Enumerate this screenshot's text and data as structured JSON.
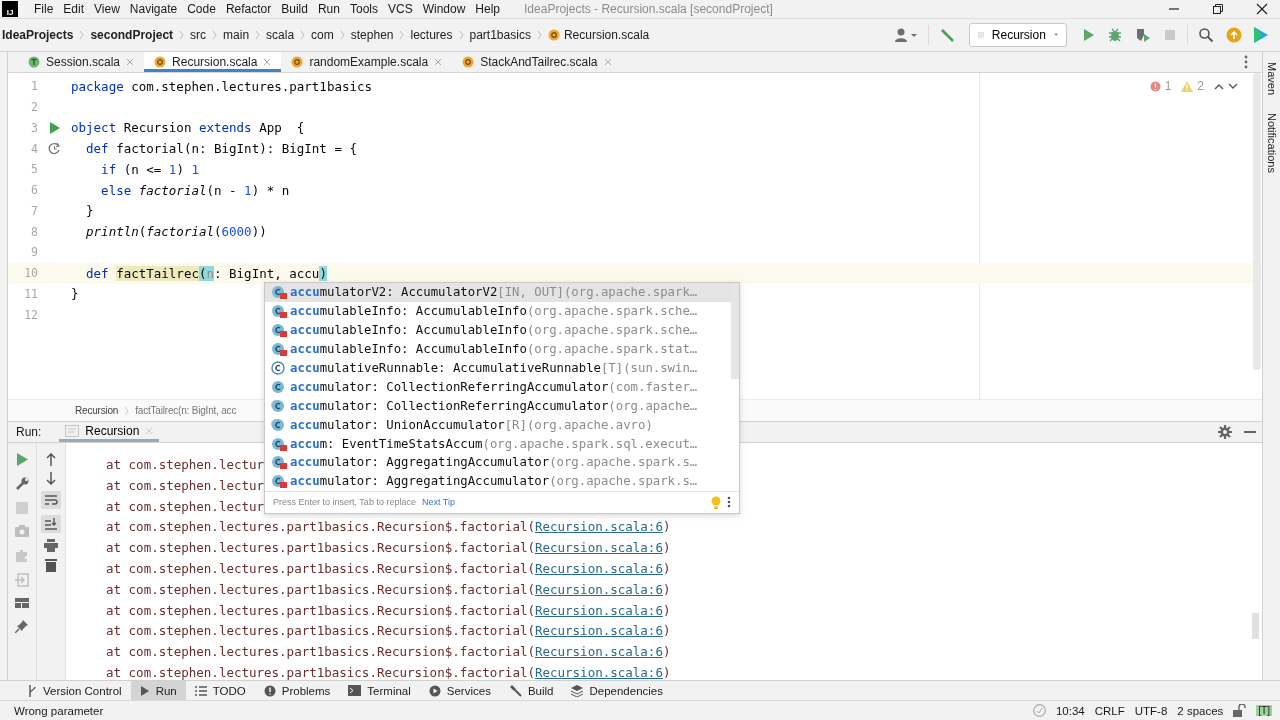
{
  "title_bar": {
    "logo": "IJ",
    "menu": [
      "File",
      "Edit",
      "View",
      "Navigate",
      "Code",
      "Refactor",
      "Build",
      "Run",
      "Tools",
      "VCS",
      "Window",
      "Help"
    ],
    "title": "IdeaProjects - Recursion.scala [secondProject]"
  },
  "nav_bar": {
    "breadcrumbs": [
      {
        "label": "IdeaProjects",
        "kind": "project"
      },
      {
        "label": "secondProject",
        "kind": "project"
      },
      {
        "label": "src",
        "kind": "dir"
      },
      {
        "label": "main",
        "kind": "dir"
      },
      {
        "label": "scala",
        "kind": "dir"
      },
      {
        "label": "com",
        "kind": "dir"
      },
      {
        "label": "stephen",
        "kind": "dir"
      },
      {
        "label": "lectures",
        "kind": "dir"
      },
      {
        "label": "part1basics",
        "kind": "dir"
      },
      {
        "label": "Recursion.scala",
        "kind": "file"
      }
    ],
    "run_config": "Recursion"
  },
  "tabs": [
    {
      "label": "Session.scala",
      "kind": "worksheet",
      "selected": false
    },
    {
      "label": "Recursion.scala",
      "kind": "object",
      "selected": true
    },
    {
      "label": "randomExample.scala",
      "kind": "object",
      "selected": false
    },
    {
      "label": "StackAndTailrec.scala",
      "kind": "object",
      "selected": false
    }
  ],
  "editor": {
    "inspections": {
      "errors": "1",
      "warnings": "2"
    },
    "lines": [
      {
        "number": "1",
        "kind": "plain",
        "current": false,
        "tokens": [
          {
            "t": "package",
            "kind": "keyword"
          },
          {
            "t": " com.stephen.lectures.part1basics",
            "kind": "plain"
          }
        ]
      },
      {
        "number": "2",
        "kind": "plain",
        "current": false
      },
      {
        "number": "3",
        "kind": "run",
        "current": false,
        "tokens": [
          {
            "t": "object",
            "kind": "keyword"
          },
          {
            "t": " Recursion ",
            "kind": "plain"
          },
          {
            "t": "extends",
            "kind": "keyword"
          },
          {
            "t": " App  {",
            "kind": "plain"
          }
        ]
      },
      {
        "number": "4",
        "kind": "recursion",
        "current": false,
        "tokens": [
          {
            "t": "  def",
            "kind": "keyword"
          },
          {
            "t": " factorial(n: BigInt): BigInt = {",
            "kind": "plain"
          }
        ]
      },
      {
        "number": "5",
        "kind": "plain",
        "current": false,
        "tokens": [
          {
            "t": "    if",
            "kind": "keyword"
          },
          {
            "t": " (n <= ",
            "kind": "plain"
          },
          {
            "t": "1",
            "kind": "number"
          },
          {
            "t": ") ",
            "kind": "plain"
          },
          {
            "t": "1",
            "kind": "number"
          }
        ]
      },
      {
        "number": "6",
        "kind": "plain",
        "current": false,
        "tokens": [
          {
            "t": "    else ",
            "kind": "keyword"
          },
          {
            "t": "factorial",
            "kind": "call"
          },
          {
            "t": "(n - ",
            "kind": "plain"
          },
          {
            "t": "1",
            "kind": "number"
          },
          {
            "t": ") * n",
            "kind": "plain"
          }
        ]
      },
      {
        "number": "7",
        "kind": "plain",
        "current": false,
        "tokens": [
          {
            "t": "  }",
            "kind": "plain"
          }
        ]
      },
      {
        "number": "8",
        "kind": "plain",
        "current": false,
        "tokens": [
          {
            "t": "  println",
            "kind": "call"
          },
          {
            "t": "(",
            "kind": "plain"
          },
          {
            "t": "factorial",
            "kind": "call"
          },
          {
            "t": "(",
            "kind": "plain"
          },
          {
            "t": "6000",
            "kind": "number"
          },
          {
            "t": "))",
            "kind": "plain"
          }
        ]
      },
      {
        "number": "9",
        "kind": "plain",
        "current": false
      },
      {
        "number": "10",
        "kind": "plain",
        "current": true,
        "tokens": [
          {
            "t": "  def ",
            "kind": "keyword"
          },
          {
            "t": "factTailrec",
            "kind": "usage"
          },
          {
            "t": "(",
            "kind": "brace"
          },
          {
            "t": "n",
            "kind": "unused"
          },
          {
            "t": ": BigInt, accu",
            "kind": "plain"
          },
          {
            "t": ")",
            "kind": "brace"
          }
        ]
      },
      {
        "number": "11",
        "kind": "plain",
        "current": false,
        "tokens": [
          {
            "t": "}",
            "kind": "plain"
          }
        ]
      },
      {
        "number": "12",
        "kind": "plain",
        "current": false
      }
    ],
    "breadcrumbs": [
      "Recursion",
      "factTailrec(n: BigInt, acc"
    ]
  },
  "completion": {
    "items": [
      {
        "match": "accu",
        "rest": "mulatorV2: AccumulatorV2",
        "type_args": "[IN, OUT]",
        "location": "(org.apache.spark…",
        "kind": "private",
        "selected": true
      },
      {
        "match": "accu",
        "rest": "mulableInfo: AccumulableInfo",
        "location": "(org.apache.spark.sche…",
        "kind": "private",
        "selected": false
      },
      {
        "match": "accu",
        "rest": "mulableInfo: AccumulableInfo",
        "location": "(org.apache.spark.sche…",
        "kind": "private",
        "selected": false
      },
      {
        "match": "accu",
        "rest": "mulableInfo: AccumulableInfo",
        "location": "(org.apache.spark.stat…",
        "kind": "private",
        "selected": false
      },
      {
        "match": "accu",
        "rest": "mulativeRunnable: AccumulativeRunnable",
        "type_args": "[T]",
        "location": "(sun.swin…",
        "kind": "abstract",
        "selected": false
      },
      {
        "match": "accu",
        "rest": "mulator: CollectionReferringAccumulator",
        "location": "(com.faster…",
        "kind": "plain",
        "selected": false
      },
      {
        "match": "accu",
        "rest": "mulator: CollectionReferringAccumulator",
        "location": "(org.apache…",
        "kind": "stacked",
        "selected": false
      },
      {
        "match": "accu",
        "rest": "mulator: UnionAccumulator",
        "type_args": "[R]",
        "location": "(org.apache.avro)",
        "kind": "stacked",
        "selected": false
      },
      {
        "match": "accu",
        "rest": "m: EventTimeStatsAccum",
        "location": "(org.apache.spark.sql.execut…",
        "kind": "private",
        "selected": false
      },
      {
        "match": "accu",
        "rest": "mulator: AggregatingAccumulator",
        "location": "(org.apache.spark.s…",
        "kind": "private",
        "selected": false
      },
      {
        "match": "accu",
        "rest": "mulator: AggregatingAccumulator",
        "location": "(org.apache.spark.s…",
        "kind": "private",
        "selected": false
      }
    ],
    "hint": "Press Enter to insert, Tab to replace",
    "tip_link": "Next Tip"
  },
  "run_panel": {
    "label": "Run:",
    "tab": "Recursion",
    "console": [
      {
        "text": "at com.stephen.lectur"
      },
      {
        "text": "at com.stephen.lectur"
      },
      {
        "text": "at com.stephen.lectur"
      },
      {
        "text": "at com.stephen.lectures.part1basics.Recursion$.factorial(",
        "link": "Recursion.scala:6",
        "tail": ")"
      },
      {
        "text": "at com.stephen.lectures.part1basics.Recursion$.factorial(",
        "link": "Recursion.scala:6",
        "tail": ")"
      },
      {
        "text": "at com.stephen.lectures.part1basics.Recursion$.factorial(",
        "link": "Recursion.scala:6",
        "tail": ")"
      },
      {
        "text": "at com.stephen.lectures.part1basics.Recursion$.factorial(",
        "link": "Recursion.scala:6",
        "tail": ")"
      },
      {
        "text": "at com.stephen.lectures.part1basics.Recursion$.factorial(",
        "link": "Recursion.scala:6",
        "tail": ")"
      },
      {
        "text": "at com.stephen.lectures.part1basics.Recursion$.factorial(",
        "link": "Recursion.scala:6",
        "tail": ")"
      },
      {
        "text": "at com.stephen.lectures.part1basics.Recursion$.factorial(",
        "link": "Recursion.scala:6",
        "tail": ")"
      },
      {
        "text": "at com.stephen.lectures.part1basics.Recursion$.factorial(",
        "link": "Recursion.scala:6",
        "tail": ")"
      }
    ]
  },
  "right_strip": [
    "Maven",
    "Notifications"
  ],
  "tool_windows": [
    {
      "label": "Version Control",
      "kind": "vcs",
      "selected": false
    },
    {
      "label": "Run",
      "kind": "run",
      "selected": true
    },
    {
      "label": "TODO",
      "kind": "todo",
      "selected": false
    },
    {
      "label": "Problems",
      "kind": "problems",
      "selected": false
    },
    {
      "label": "Terminal",
      "kind": "terminal",
      "selected": false
    },
    {
      "label": "Services",
      "kind": "services",
      "selected": false
    },
    {
      "label": "Build",
      "kind": "build",
      "selected": false
    },
    {
      "label": "Dependencies",
      "kind": "dependencies",
      "selected": false
    }
  ],
  "status_bar": {
    "message": "Wrong parameter",
    "position": "10:34",
    "line_separator": "CRLF",
    "encoding": "UTF-8",
    "indent": "2 spaces",
    "mode": "[T]"
  }
}
